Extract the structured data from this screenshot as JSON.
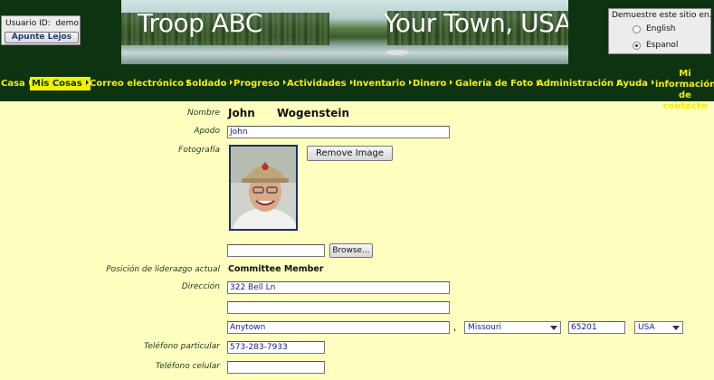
{
  "header": {
    "user_id_label": "Usuario ID:",
    "user_id_value": "demo",
    "logout_label": "Apunte Lejos",
    "banner_title_left": "Troop ABC",
    "banner_title_right": "Your Town, USA",
    "demo_label": "Demuestre este sitio en..",
    "languages": [
      {
        "label": "English",
        "selected": false
      },
      {
        "label": "Espanol",
        "selected": true
      }
    ]
  },
  "nav": {
    "items": [
      {
        "label": "Casa",
        "active": false
      },
      {
        "label": "Mis Cosas",
        "active": true
      },
      {
        "label": "Correo electrónico",
        "active": false
      },
      {
        "label": "Soldado",
        "active": false
      },
      {
        "label": "Progreso",
        "active": false
      },
      {
        "label": "Actividades",
        "active": false
      },
      {
        "label": "Inventario",
        "active": false
      },
      {
        "label": "Dinero",
        "active": false
      },
      {
        "label": "Galería de Foto",
        "active": false
      },
      {
        "label": "Administración",
        "active": false
      },
      {
        "label": "Ayuda",
        "active": false
      }
    ],
    "contact_line1": "Mi",
    "contact_line2": "información",
    "contact_line3": "de contacto"
  },
  "form": {
    "name_label": "Nombre",
    "first_name": "John",
    "last_name": "Wogenstein",
    "nickname_label": "Apodo",
    "nickname_value": "John",
    "photo_label": "Fotografía",
    "remove_image_label": "Remove Image",
    "file_value": "",
    "browse_label": "Browse...",
    "leadership_label": "Posición de liderazgo actual",
    "leadership_value": "Committee Member",
    "address_label": "Dirección",
    "address_line1": "322 Bell Ln",
    "address_line2": "",
    "city": "Anytown",
    "comma": ",",
    "state": "Missouri",
    "zip": "65201",
    "country": "USA",
    "home_phone_label": "Teléfono particular",
    "home_phone_value": "573-283-7933",
    "cell_phone_label": "Teléfono celular",
    "cell_phone_value": ""
  }
}
